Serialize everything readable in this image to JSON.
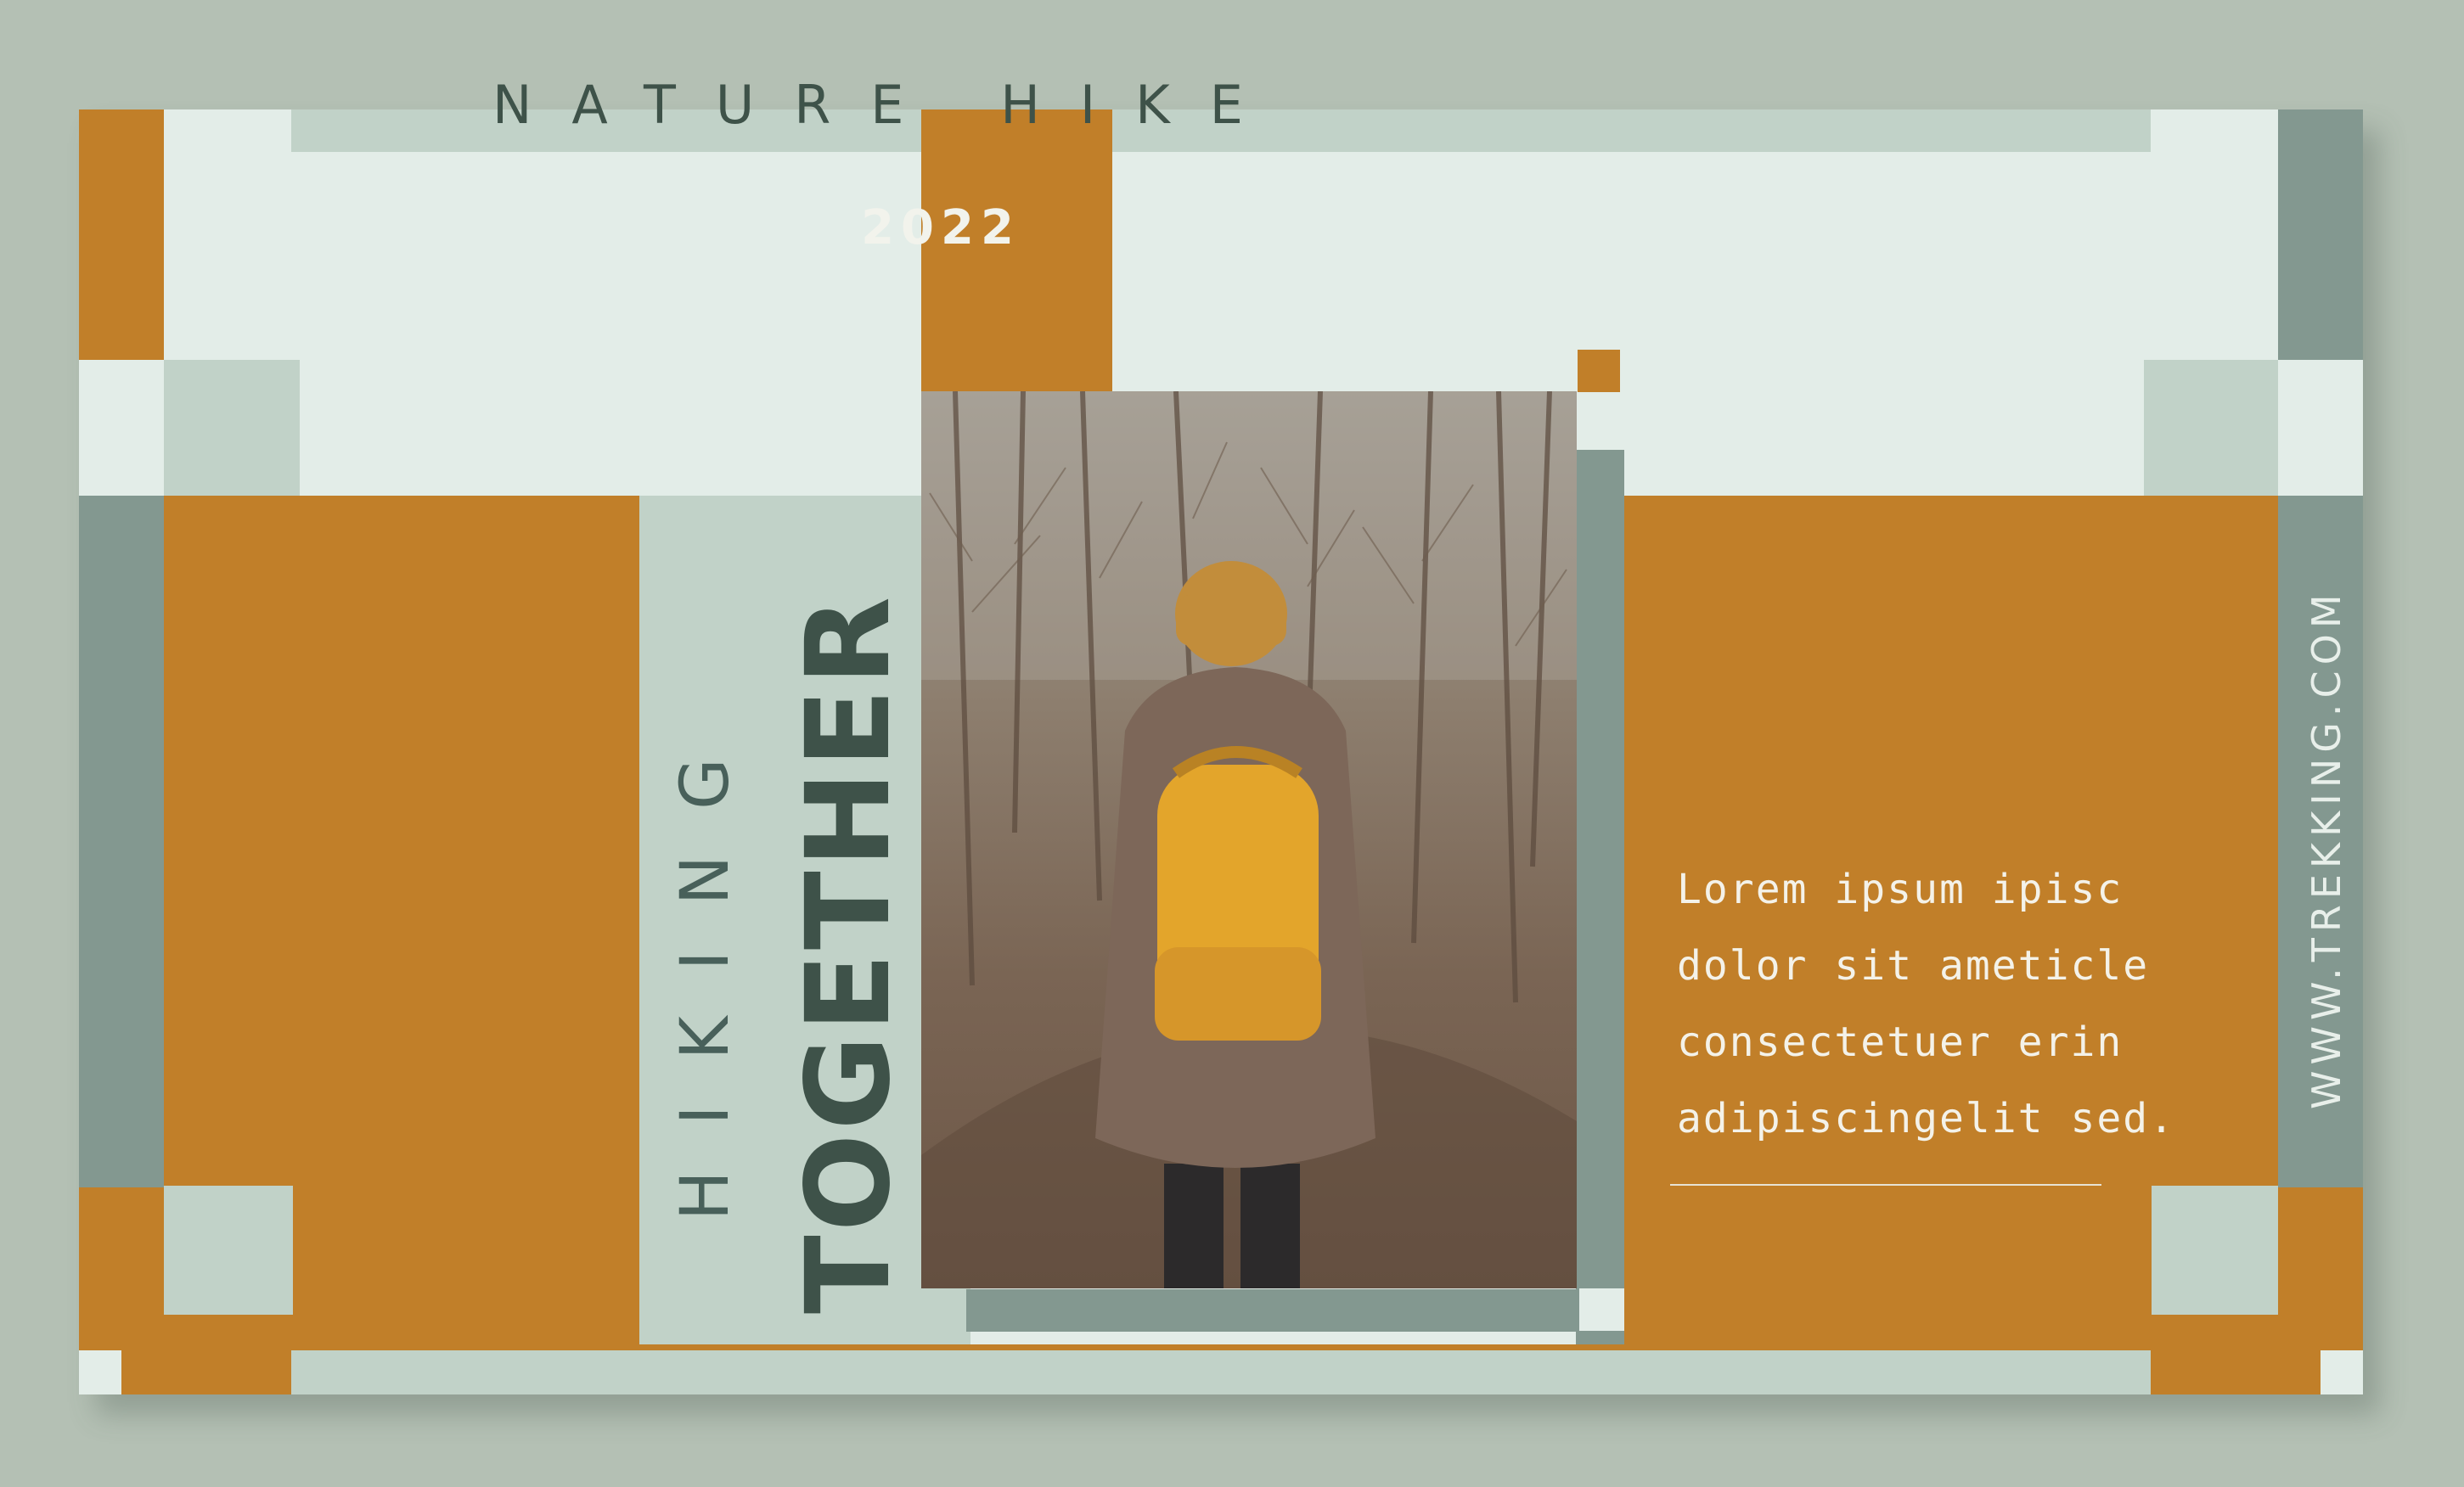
{
  "header": {
    "title": "NATURE HIKE",
    "year": "2022"
  },
  "headline": {
    "line1": "HIKING",
    "line2": "TOGETHER"
  },
  "body": {
    "lines": [
      "Lorem ipsum ipisc",
      "dolor sit ameticle",
      "consectetuer erin",
      "adipiscingelit sed."
    ]
  },
  "website": "WWW.TREKKING.COM",
  "photo": {
    "subject": "hiker-with-yellow-backpack"
  },
  "colors": {
    "background": "#b4c0b4",
    "ochre": "#c17f29",
    "mint": "#e3ede8",
    "sage": "#c1d2c8",
    "steel": "#839890",
    "dark_green": "#3e5249",
    "backpack": "#e3a52b"
  }
}
